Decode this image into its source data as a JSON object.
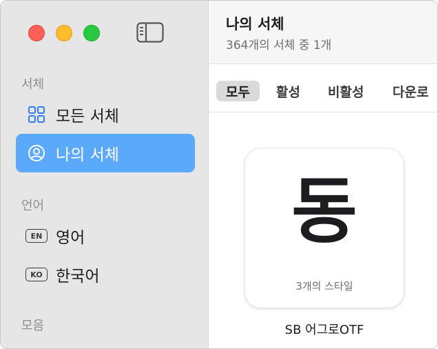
{
  "window": {
    "title": "나의 서체",
    "subtitle": "364개의 서체 중 1개"
  },
  "sidebar": {
    "sections": {
      "fonts": "서체",
      "language": "언어",
      "collections": "모음"
    },
    "items": [
      {
        "label": "모든 서체",
        "icon": "grid-icon",
        "selected": false
      },
      {
        "label": "나의 서체",
        "icon": "person-circle-icon",
        "selected": true
      },
      {
        "label": "영어",
        "badge": "EN",
        "selected": false
      },
      {
        "label": "한국어",
        "badge": "KO",
        "selected": false
      }
    ]
  },
  "tabs": [
    {
      "label": "모두",
      "active": true
    },
    {
      "label": "활성",
      "active": false
    },
    {
      "label": "비활성",
      "active": false
    },
    {
      "label": "다운로",
      "active": false
    }
  ],
  "font_card": {
    "preview": "동",
    "styles": "3개의 스타일",
    "name": "SB 어그로OTF"
  },
  "colors": {
    "accent": "#5aa9fb",
    "icon_blue": "#2f7cf6",
    "sidebar_bg": "#e6e6e6"
  }
}
